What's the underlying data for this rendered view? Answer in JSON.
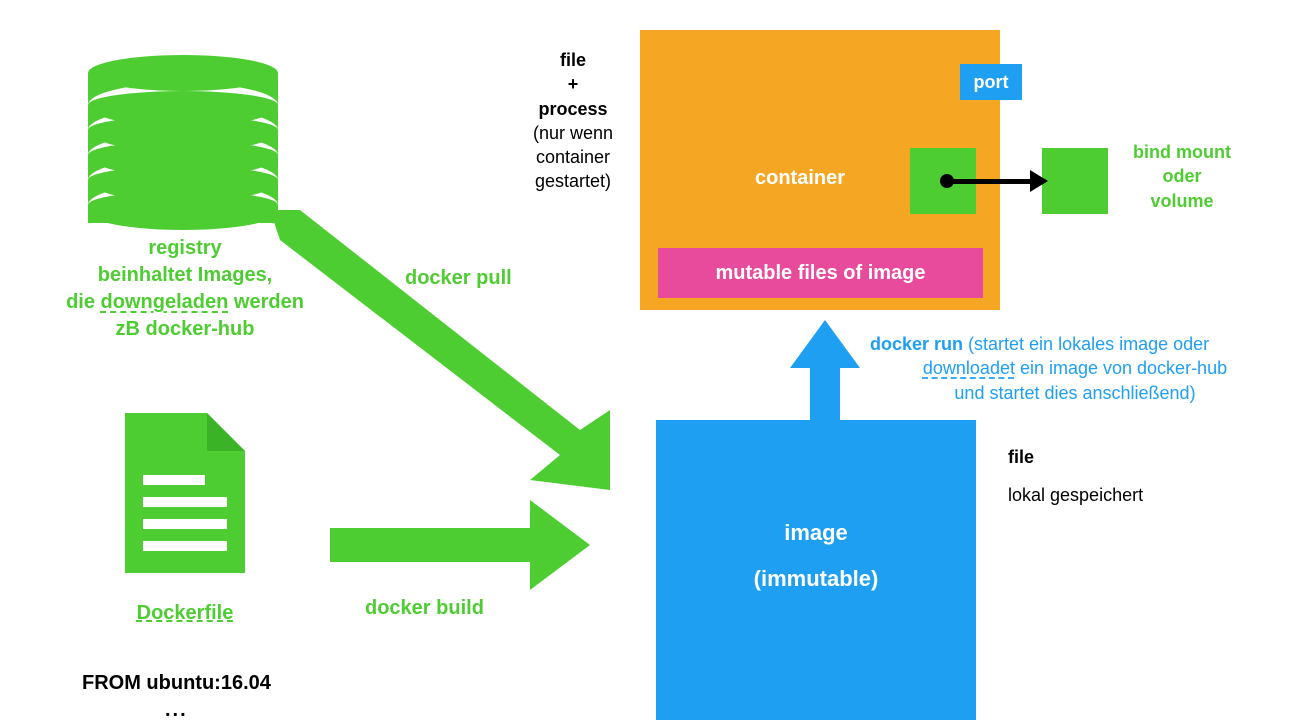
{
  "registry": {
    "caption_l1": "registry",
    "caption_l2": "beinhaltet Images,",
    "caption_l3_a": "die ",
    "caption_l3_b": "downgeladen",
    "caption_l3_c": " werden",
    "caption_l4": "zB docker-hub"
  },
  "dockerfile": {
    "caption": "Dockerfile",
    "code1": "FROM ubuntu:16.04",
    "code2": "..."
  },
  "arrows": {
    "pull": "docker pull",
    "build": "docker build",
    "run_prefix": "docker run ",
    "run_l1": "(startet ein lokales image oder",
    "run_l2a": "downloadet",
    "run_l2b": " ein image von docker-hub",
    "run_l3": "und startet dies anschließend)"
  },
  "container": {
    "label": "container",
    "mutable": "mutable files of image",
    "port": "port",
    "side_l1": "file",
    "side_l2": "+",
    "side_l3": "process",
    "side_l4": "(nur wenn",
    "side_l5": "container",
    "side_l6": "gestartet)"
  },
  "mount": {
    "l1": "bind mount",
    "l2": "oder",
    "l3": "volume"
  },
  "image": {
    "l1": "image",
    "l2": "(immutable)",
    "side_l1": "file",
    "side_l2": "lokal gespeichert"
  },
  "colors": {
    "green": "#4ECD32",
    "blue": "#1E9FF2",
    "orange": "#F5A623",
    "pink": "#E94B9C"
  }
}
